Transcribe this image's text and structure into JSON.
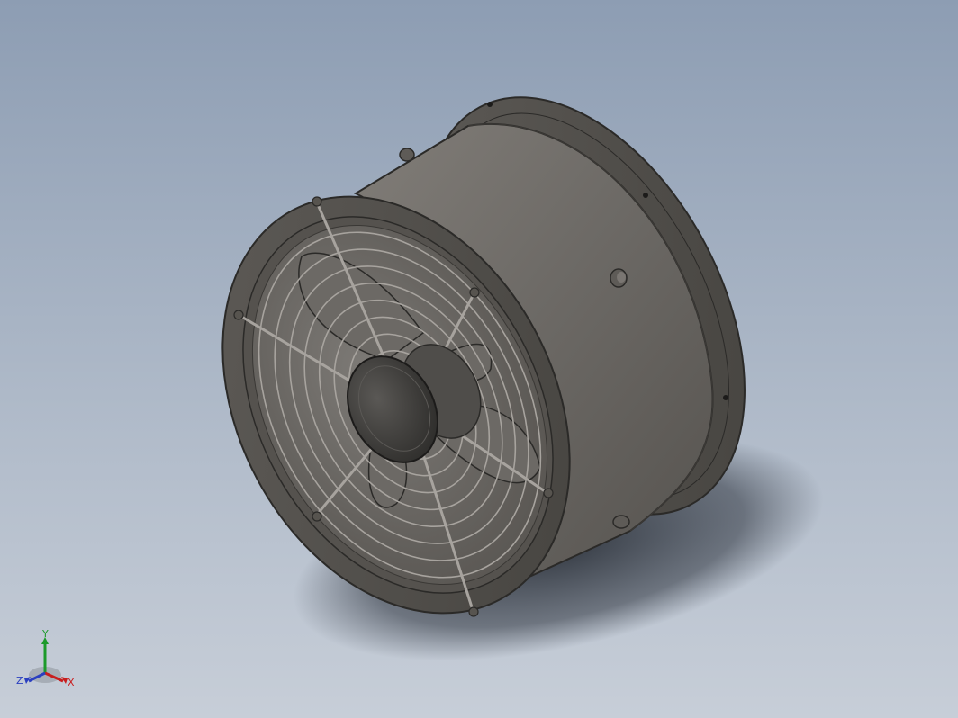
{
  "scene": {
    "subject": "axial-fan-assembly",
    "background_colors": {
      "top": "#8d9db3",
      "bottom": "#c7ced8"
    },
    "model_colors": {
      "housing": "#6f6c68",
      "housing_dark": "#4a4845",
      "edge": "#2b2a28",
      "guard": "#9c9893",
      "hub": "#3e3d3b"
    }
  },
  "triad": {
    "x_label": "X",
    "y_label": "Y",
    "z_label": "Z",
    "x_color": "#c81e1e",
    "y_color": "#1c9a2a",
    "z_color": "#2a3fc0"
  }
}
